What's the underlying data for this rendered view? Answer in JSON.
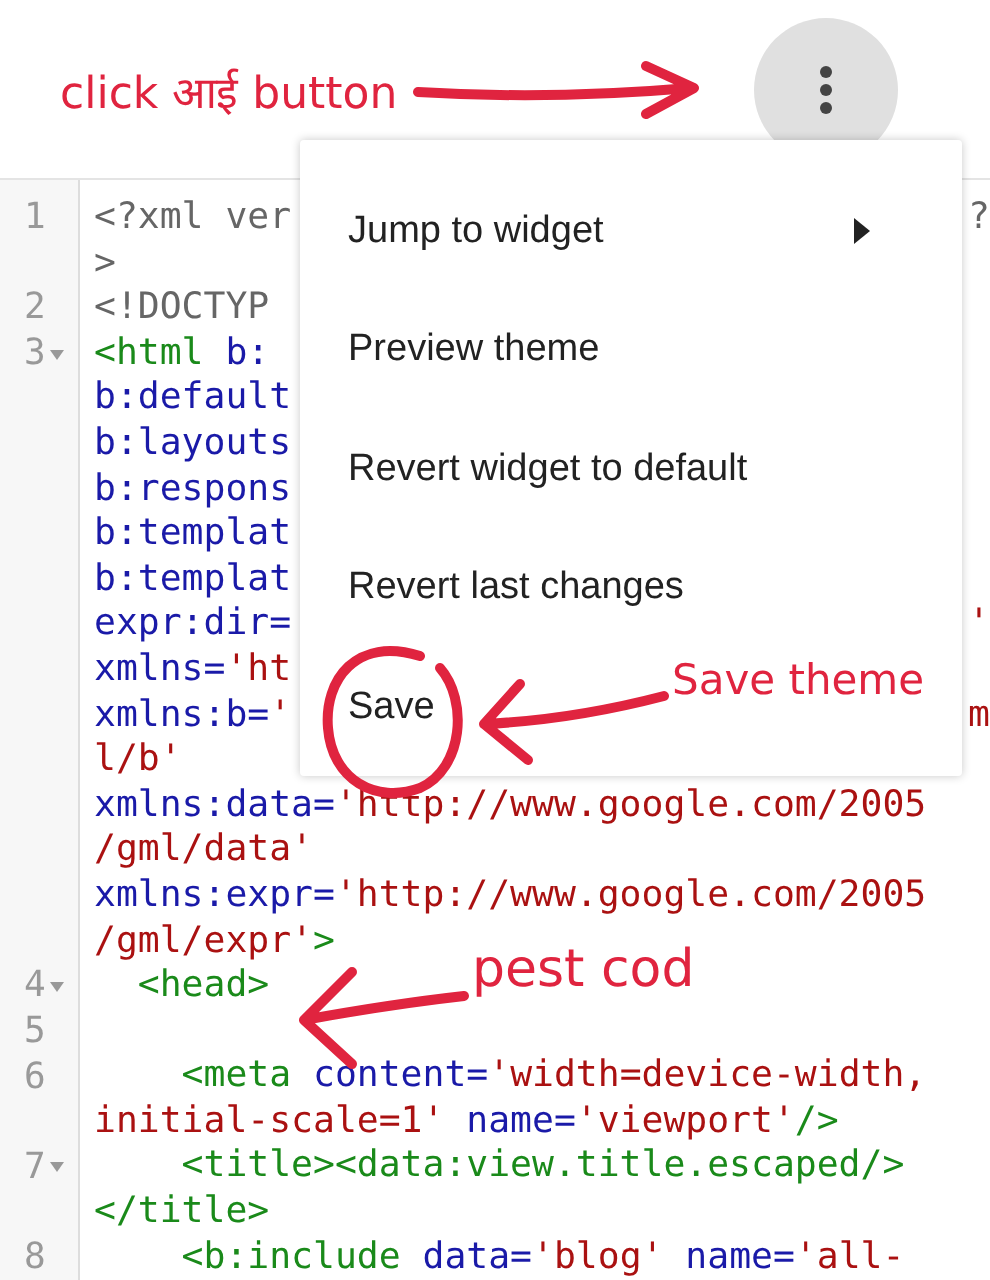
{
  "toolbar": {
    "annotation": "click आई button"
  },
  "code": [
    {
      "num": "1",
      "segs": [
        {
          "t": "<?xml ver",
          "kind": "plain"
        }
      ],
      "tail": {
        "t": "?",
        "kind": "plain"
      }
    },
    {
      "segs": [
        {
          "t": ">",
          "kind": "plain"
        }
      ]
    },
    {
      "num": "2",
      "segs": [
        {
          "t": "<!DOCTYP",
          "kind": "plain"
        }
      ]
    },
    {
      "num": "3",
      "fold": true,
      "segs": [
        {
          "t": "<html",
          "kind": "tag"
        },
        {
          "t": " b:",
          "kind": "attr"
        }
      ]
    },
    {
      "segs": [
        {
          "t": "b:default",
          "kind": "attr"
        }
      ]
    },
    {
      "segs": [
        {
          "t": "b:layouts",
          "kind": "attr"
        }
      ]
    },
    {
      "segs": [
        {
          "t": "b:respons",
          "kind": "attr"
        }
      ]
    },
    {
      "segs": [
        {
          "t": "b:templat",
          "kind": "attr"
        }
      ]
    },
    {
      "segs": [
        {
          "t": "b:templat",
          "kind": "attr"
        }
      ]
    },
    {
      "segs": [
        {
          "t": "expr:dir=",
          "kind": "attr"
        }
      ],
      "tail": {
        "t": "'",
        "kind": "value"
      }
    },
    {
      "segs": [
        {
          "t": "xmlns=",
          "kind": "attr"
        },
        {
          "t": "'ht",
          "kind": "value"
        }
      ]
    },
    {
      "segs": [
        {
          "t": "xmlns:b=",
          "kind": "attr"
        },
        {
          "t": "'",
          "kind": "value"
        }
      ],
      "tail": {
        "t": "m",
        "kind": "value"
      }
    },
    {
      "segs": [
        {
          "t": "l/b'",
          "kind": "value"
        }
      ]
    },
    {
      "segs": [
        {
          "t": "xmlns:data=",
          "kind": "attr"
        },
        {
          "t": "'http://www.google.com/2005",
          "kind": "value"
        }
      ]
    },
    {
      "segs": [
        {
          "t": "/gml/data'",
          "kind": "value"
        }
      ]
    },
    {
      "segs": [
        {
          "t": "xmlns:expr=",
          "kind": "attr"
        },
        {
          "t": "'http://www.google.com/2005",
          "kind": "value"
        }
      ]
    },
    {
      "segs": [
        {
          "t": "/gml/expr'",
          "kind": "value"
        },
        {
          "t": ">",
          "kind": "tag"
        }
      ]
    },
    {
      "num": "4",
      "fold": true,
      "segs": [
        {
          "t": "  <head>",
          "kind": "tag"
        }
      ]
    },
    {
      "num": "5"
    },
    {
      "num": "6",
      "segs": [
        {
          "t": "    <meta",
          "kind": "tag"
        },
        {
          "t": " content=",
          "kind": "attr"
        },
        {
          "t": "'width=device-width,",
          "kind": "value"
        }
      ]
    },
    {
      "segs": [
        {
          "t": "initial-scale=1'",
          "kind": "value"
        },
        {
          "t": " name=",
          "kind": "attr"
        },
        {
          "t": "'viewport'",
          "kind": "value"
        },
        {
          "t": "/>",
          "kind": "tag"
        }
      ]
    },
    {
      "num": "7",
      "fold": true,
      "segs": [
        {
          "t": "    <title><data:view.title.escaped/>",
          "kind": "tag"
        }
      ]
    },
    {
      "segs": [
        {
          "t": "</title>",
          "kind": "tag"
        }
      ]
    },
    {
      "num": "8",
      "segs": [
        {
          "t": "    <b:include",
          "kind": "tag"
        },
        {
          "t": " data=",
          "kind": "attr"
        },
        {
          "t": "'blog'",
          "kind": "value"
        },
        {
          "t": " name=",
          "kind": "attr"
        },
        {
          "t": "'all-",
          "kind": "value"
        }
      ]
    }
  ],
  "menu": {
    "items": [
      {
        "label": "Jump to widget",
        "submenu": true
      },
      {
        "label": "Preview theme",
        "submenu": false
      },
      {
        "label": "Revert widget to default",
        "submenu": false
      },
      {
        "label": "Revert last changes",
        "submenu": false
      },
      {
        "label": "Save",
        "submenu": false
      }
    ]
  },
  "annotations": [
    {
      "text": "Save theme",
      "kind": "save"
    },
    {
      "text": "pest cod",
      "kind": "paste"
    }
  ]
}
